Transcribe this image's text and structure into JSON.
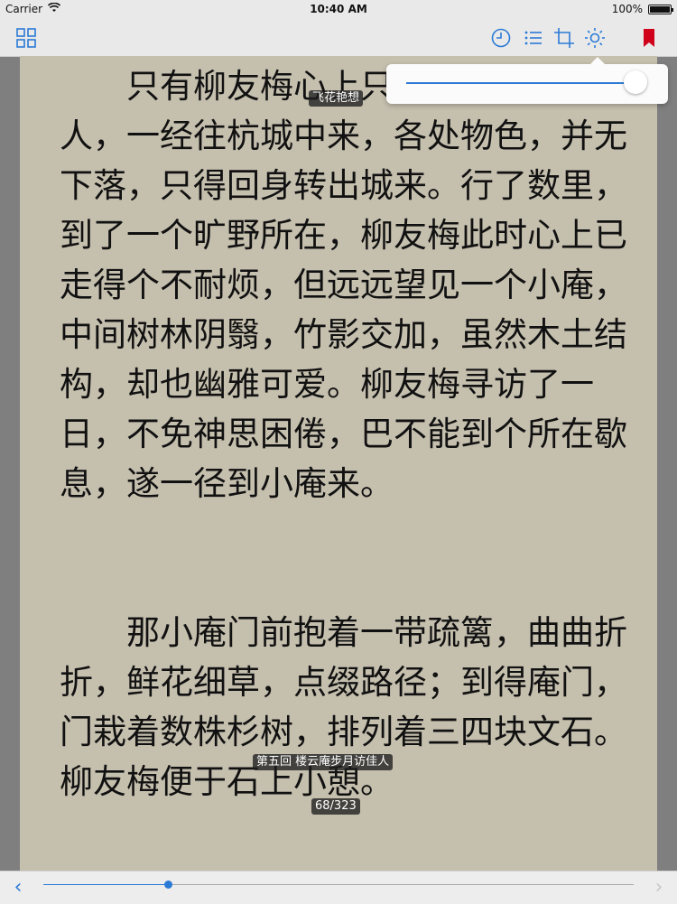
{
  "status": {
    "carrier": "Carrier",
    "time": "10:40 AM",
    "battery": "100%"
  },
  "toolbar": {
    "icons": [
      "grid-icon",
      "clock-icon",
      "list-icon",
      "crop-icon",
      "brightness-icon",
      "bookmark-icon"
    ],
    "accent": "#2b7ad6",
    "bookmark_color": "#d0021b"
  },
  "overlays": {
    "top_label": "飞花艳想",
    "chapter_label": "第五回 楼云庵步月访佳人",
    "page_label": "68/323"
  },
  "brightness": {
    "level": 0.95
  },
  "content": {
    "paragraphs": [
      "　　只有柳友梅心上只觉得有一个佳人，一经往杭城中来，各处物色，并无下落，只得回身转出城来。行了数里，到了一个旷野所在，柳友梅此时心上已走得个不耐烦，但远远望见一个小庵，中间树林阴翳，竹影交加，虽然木土结构，却也幽雅可爱。柳友梅寻访了一日，不免神思困倦，巴不能到个所在歇息，遂一径到小庵来。",
      "　　那小庵门前抱着一带疏篱，曲曲折折，鲜花细草，点缀路径；到得庵门，门栽着数株杉树，排列着三四块文石。柳友梅便于石上小憩。"
    ]
  },
  "progress": {
    "current": 68,
    "total": 323,
    "prev_label": "‹",
    "next_label": "›"
  }
}
